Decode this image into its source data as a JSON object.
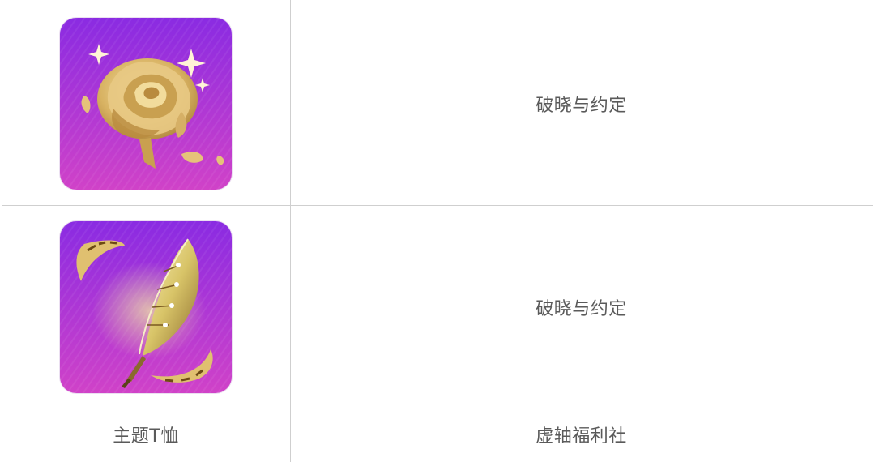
{
  "table": {
    "rows": [
      {
        "item": {
          "icon": "golden-rose-icon",
          "label": ""
        },
        "source": "破晓与约定"
      },
      {
        "item": {
          "icon": "golden-quill-feather-icon",
          "label": ""
        },
        "source": "破晓与约定"
      },
      {
        "item": {
          "icon": "",
          "label": "主题T恤"
        },
        "source": "虚轴福利社"
      }
    ]
  },
  "colors": {
    "border": "#cfcfcf",
    "text": "#5a5a5a",
    "icon_bg_top": "#8a2be2",
    "icon_bg_bottom": "#d042c8",
    "gold": "#e2c27a"
  }
}
